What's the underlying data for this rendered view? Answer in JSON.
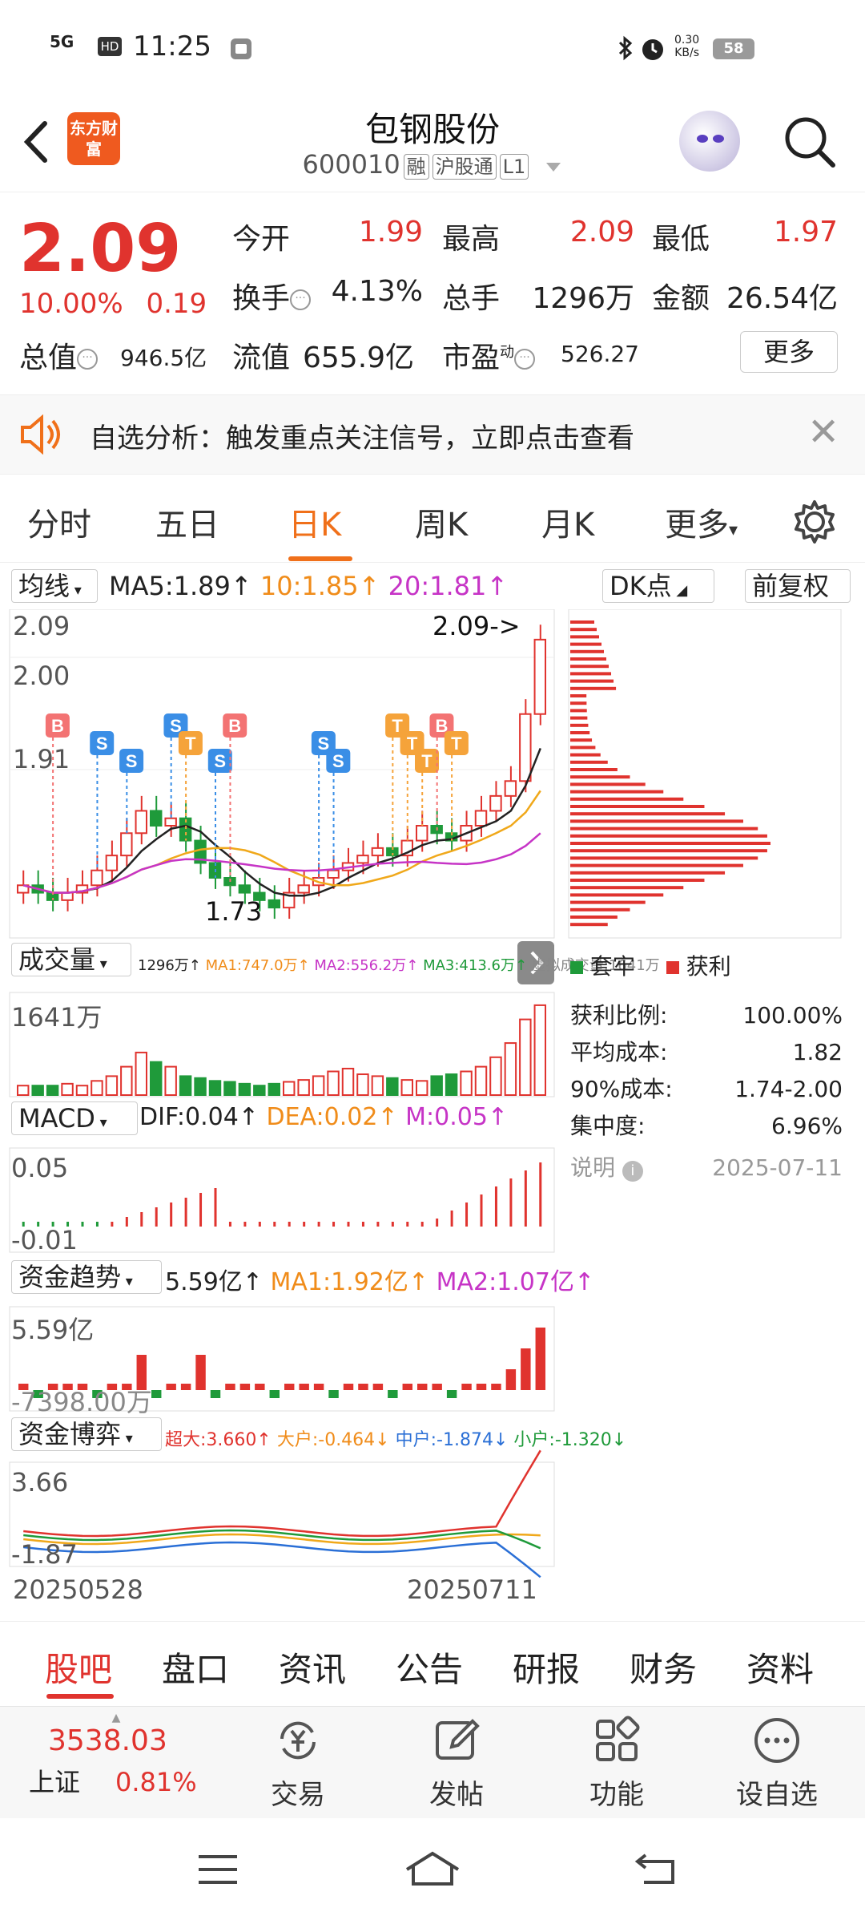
{
  "status_bar": {
    "network": "5G",
    "hd": "HD",
    "time": "11:25",
    "speed_value": "0.30",
    "speed_unit": "KB/s",
    "battery": "58"
  },
  "header": {
    "logo_text": "东方财富",
    "stock_name": "包钢股份",
    "stock_code": "600010",
    "tags": [
      "融",
      "沪股通",
      "L1"
    ]
  },
  "quote": {
    "price": "2.09",
    "change_pct": "10.00%",
    "change_amt": "0.19",
    "open_label": "今开",
    "open": "1.99",
    "high_label": "最高",
    "high": "2.09",
    "low_label": "最低",
    "low": "1.97",
    "turnover_label": "换手",
    "turnover": "4.13%",
    "volume_label": "总手",
    "volume": "1296万",
    "amount_label": "金额",
    "amount": "26.54亿",
    "mktcap_label": "总值",
    "mktcap": "946.5亿",
    "float_label": "流值",
    "float": "655.9亿",
    "pe_label": "市盈",
    "pe_sup": "动",
    "pe": "526.27",
    "more_label": "更多"
  },
  "banner": {
    "text": "自选分析：触发重点关注信号，立即点击查看"
  },
  "period_tabs": [
    "分时",
    "五日",
    "日K",
    "周K",
    "月K",
    "更多"
  ],
  "active_period": "日K",
  "chart": {
    "ma_selector": "均线",
    "ma5": "MA5:1.89",
    "ma10": "10:1.85",
    "ma20": "20:1.81",
    "dk_selector": "DK点",
    "adjust_label": "前复权",
    "price_axis": [
      "2.09",
      "2.00",
      "1.91"
    ],
    "last_price_marker": "2.09->",
    "low_marker": "1.73",
    "vol_selector": "成交量",
    "vol_line": [
      "1296万↑",
      "MA1:747.0万↑",
      "MA2:556.2万↑",
      "MA3:413.6万↑",
      "虚拟成交量:1641万"
    ],
    "vol_axis_top": "1641万",
    "macd_selector": "MACD",
    "dif": "DIF:0.04",
    "dea": "DEA:0.02",
    "m": "M:0.05",
    "macd_axis_top": "0.05",
    "macd_axis_bottom": "-0.01",
    "fund_selector": "资金趋势",
    "fund_val": "5.59亿",
    "fund_ma1": "MA1:1.92亿",
    "fund_ma2": "MA2:1.07亿",
    "fund_axis_top": "5.59亿",
    "fund_axis_bottom": "-7398.00万",
    "game_selector": "资金博弈",
    "game_super": "超大:3.660",
    "game_large": "大户:-0.464",
    "game_mid": "中户:-1.874",
    "game_small": "小户:-1.320",
    "game_axis_top": "3.66",
    "game_axis_bottom": "-1.87",
    "date_start": "20250528",
    "date_end": "20250711",
    "chip": {
      "legend_trapped": "套牢",
      "legend_profit": "获利",
      "profit_ratio_label": "获利比例:",
      "profit_ratio": "100.00%",
      "avg_cost_label": "平均成本:",
      "avg_cost": "1.82",
      "cost90_label": "90%成本:",
      "cost90": "1.74-2.00",
      "concentration_label": "集中度:",
      "concentration": "6.96%",
      "note_label": "说明",
      "date": "2025-07-11"
    },
    "colors": {
      "up": "#e0332e",
      "down": "#1f9a3a",
      "ma5": "#222222",
      "ma10": "#f0a81a",
      "ma20": "#c634c6"
    }
  },
  "sub_tabs": [
    "股吧",
    "盘口",
    "资讯",
    "公告",
    "研报",
    "财务",
    "资料"
  ],
  "toolbar": {
    "index_value": "3538.03",
    "index_name": "上证",
    "index_change": "0.81%",
    "items": [
      "交易",
      "发帖",
      "功能",
      "设自选"
    ]
  }
}
